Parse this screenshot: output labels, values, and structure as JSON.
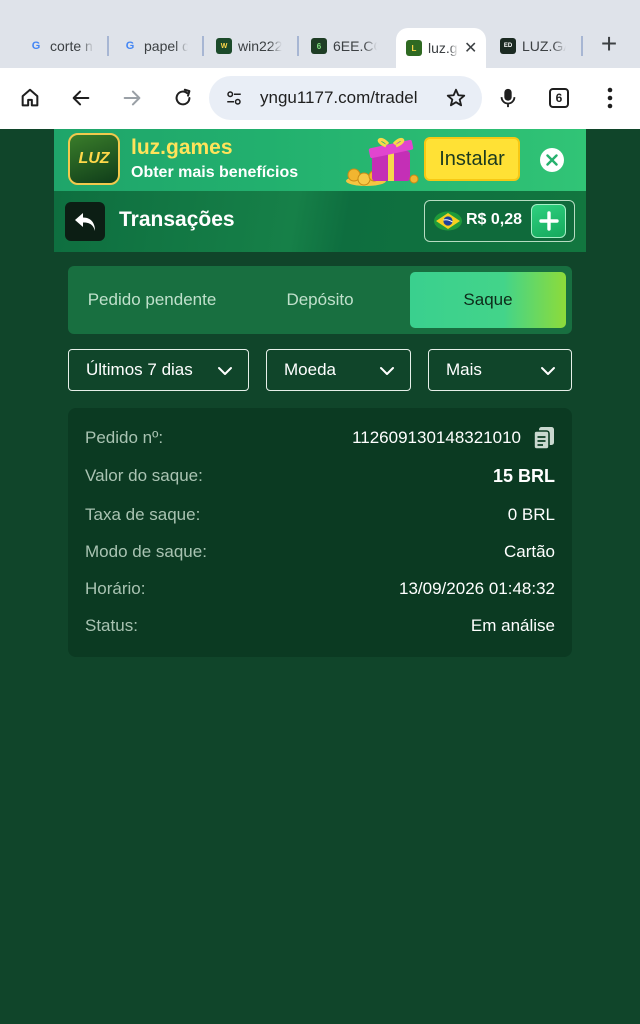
{
  "browser": {
    "tabs": [
      {
        "label": "corte n",
        "icon": "google-icon"
      },
      {
        "label": "papel d",
        "icon": "google-icon"
      },
      {
        "label": "win222",
        "icon": "win222-favicon"
      },
      {
        "label": "6EE.CO",
        "icon": "6ee-favicon"
      },
      {
        "label": "luz.g",
        "icon": "luz-favicon",
        "active": true
      },
      {
        "label": "LUZ.GA",
        "icon": "luz-ga-favicon"
      }
    ],
    "url": "yngu1177.com/tradel",
    "tab_count": "6"
  },
  "banner": {
    "logo_text": "LUZ",
    "title": "luz.games",
    "subtitle": "Obter mais benefícios",
    "install_label": "Instalar"
  },
  "header": {
    "title": "Transações",
    "balance": "R$ 0,28"
  },
  "tabs": [
    "Pedido pendente",
    "Depósito",
    "Saque"
  ],
  "active_tab": "Saque",
  "filters": {
    "period": "Últimos 7 dias",
    "currency": "Moeda",
    "more": "Mais"
  },
  "transaction": {
    "order_label": "Pedido nº:",
    "order_value": "112609130148321010",
    "amount_label": "Valor do saque:",
    "amount_value": "15 BRL",
    "fee_label": "Taxa de saque:",
    "fee_value": "0 BRL",
    "mode_label": "Modo de saque:",
    "mode_value": "Cartão",
    "time_label": "Horário:",
    "time_value": "13/09/2026 01:48:32",
    "status_label": "Status:",
    "status_value": "Em análise"
  },
  "colors": {
    "page_bg": "#10452a",
    "accent": "#3ad08e",
    "install_yellow": "#ffe135"
  }
}
